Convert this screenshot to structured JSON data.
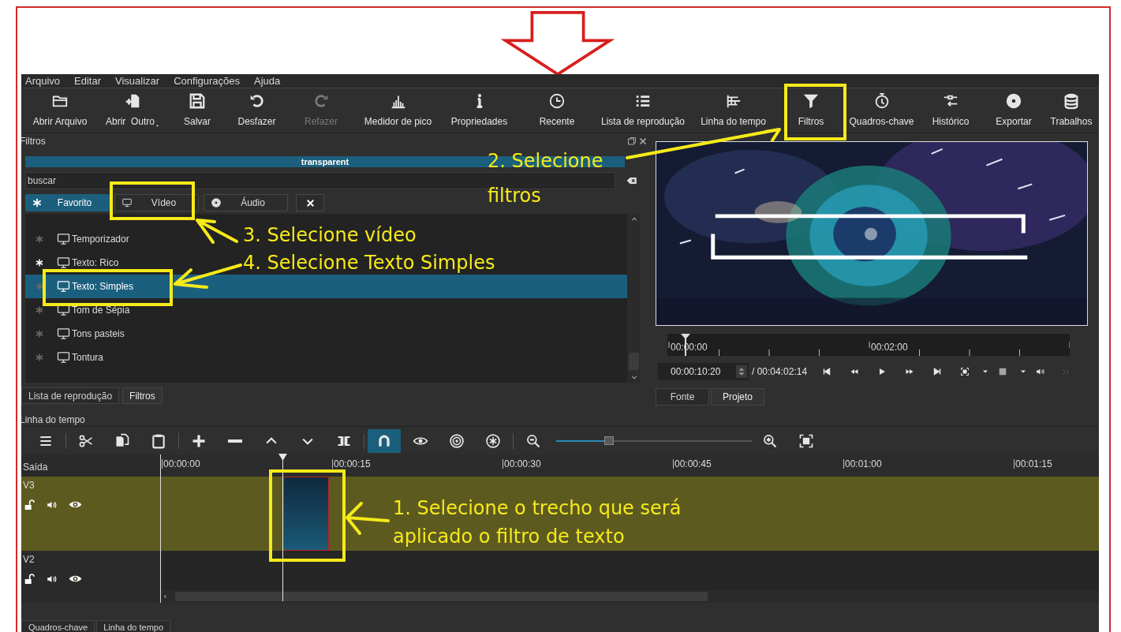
{
  "menu": [
    {
      "label": "Arquivo"
    },
    {
      "label": "Editar"
    },
    {
      "label": "Visualizar"
    },
    {
      "label": "Configurações"
    },
    {
      "label": "Ajuda"
    }
  ],
  "toolbar": [
    {
      "kind": "folder",
      "label": "Abrir Arquivo",
      "disabled": false,
      "has_menu": false
    },
    {
      "kind": "open-other",
      "label": "Abrir  Outro",
      "disabled": false,
      "has_menu": true
    },
    {
      "kind": "save",
      "label": "Salvar",
      "disabled": false,
      "has_menu": false
    },
    {
      "kind": "undo",
      "label": "Desfazer",
      "disabled": false,
      "has_menu": false
    },
    {
      "kind": "redo",
      "label": "Refazer",
      "disabled": true,
      "has_menu": false
    },
    {
      "kind": "meter",
      "label": "Medidor de pico",
      "disabled": false,
      "has_menu": false
    },
    {
      "kind": "info",
      "label": "Propriedades",
      "disabled": false,
      "has_menu": false
    },
    {
      "kind": "clock",
      "label": "Recente",
      "disabled": false,
      "has_menu": false
    },
    {
      "kind": "list",
      "label": "Lista de reprodução",
      "disabled": false,
      "has_menu": false
    },
    {
      "kind": "timeline",
      "label": "Linha do tempo",
      "disabled": false,
      "has_menu": false
    },
    {
      "kind": "filter",
      "label": "Filtros",
      "disabled": false,
      "has_menu": false
    },
    {
      "kind": "stopwatch",
      "label": "Quadros-chave",
      "disabled": false,
      "has_menu": false
    },
    {
      "kind": "history",
      "label": "Histórico",
      "disabled": false,
      "has_menu": false
    },
    {
      "kind": "disc",
      "label": "Exportar",
      "disabled": false,
      "has_menu": false
    },
    {
      "kind": "stack",
      "label": "Trabalhos",
      "disabled": false,
      "has_menu": false
    }
  ],
  "filters_panel": {
    "title": "Filtros",
    "current": "transparent",
    "search": {
      "placeholder": "buscar"
    },
    "tabs": [
      {
        "kind": "star",
        "label": "Favorito",
        "selected": true
      },
      {
        "kind": "monitor",
        "label": "Vídeo",
        "selected": false
      },
      {
        "kind": "disc",
        "label": "Áudio",
        "selected": false
      }
    ],
    "items": [
      {
        "label": "Temporizador",
        "favorite": false,
        "selected": false
      },
      {
        "label": "Texto: Rico",
        "favorite": true,
        "selected": false
      },
      {
        "label": "Texto: Simples",
        "favorite": false,
        "selected": true
      },
      {
        "label": "Tom de Sépia",
        "favorite": false,
        "selected": false
      },
      {
        "label": "Tons pasteis",
        "favorite": false,
        "selected": false
      },
      {
        "label": "Tontura",
        "favorite": false,
        "selected": false
      }
    ],
    "bottom_tabs": [
      {
        "label": "Lista de reprodução",
        "selected": false
      },
      {
        "label": "Filtros",
        "selected": true
      }
    ]
  },
  "player": {
    "ruler": [
      "00:00:00",
      "00:02:00"
    ],
    "position": "00:00:10:20",
    "duration": "/ 00:04:02:14",
    "tabs": [
      {
        "label": "Fonte",
        "selected": false
      },
      {
        "label": "Projeto",
        "selected": true
      }
    ]
  },
  "timeline": {
    "title": "Linha do tempo",
    "tools": [
      {
        "kind": "menu",
        "on": false
      },
      {
        "kind": "scissors",
        "on": false
      },
      {
        "kind": "copy",
        "on": false
      },
      {
        "kind": "paste",
        "on": false
      },
      {
        "kind": "plus",
        "on": false
      },
      {
        "kind": "minus",
        "on": false
      },
      {
        "kind": "up",
        "on": false
      },
      {
        "kind": "down",
        "on": false
      },
      {
        "kind": "split",
        "on": false
      },
      {
        "kind": "magnet",
        "on": true
      },
      {
        "kind": "scrub",
        "on": false
      },
      {
        "kind": "target",
        "on": false
      },
      {
        "kind": "ripple-all",
        "on": false
      },
      {
        "kind": "zoomout",
        "on": false
      }
    ],
    "zoom": {
      "level": 0.27
    },
    "output_label": "Saída",
    "ruler": [
      "00:00:00",
      "00:00:15",
      "00:00:30",
      "00:00:45",
      "00:01:00",
      "00:01:15"
    ],
    "tracks": [
      {
        "name": "V3",
        "selected": true
      },
      {
        "name": "V2",
        "selected": false
      }
    ],
    "bottom_tabs": [
      {
        "label": "Quadros-chave"
      },
      {
        "label": "Linha do tempo"
      }
    ]
  },
  "annotations": [
    {
      "lines": [
        "2. Selecione",
        "filtros"
      ]
    },
    {
      "lines": [
        "3. Selecione vídeo"
      ]
    },
    {
      "lines": [
        "4. Selecione Texto Simples"
      ]
    },
    {
      "lines": [
        "1. Selecione o trecho que será",
        "aplicado o filtro de texto"
      ]
    }
  ]
}
